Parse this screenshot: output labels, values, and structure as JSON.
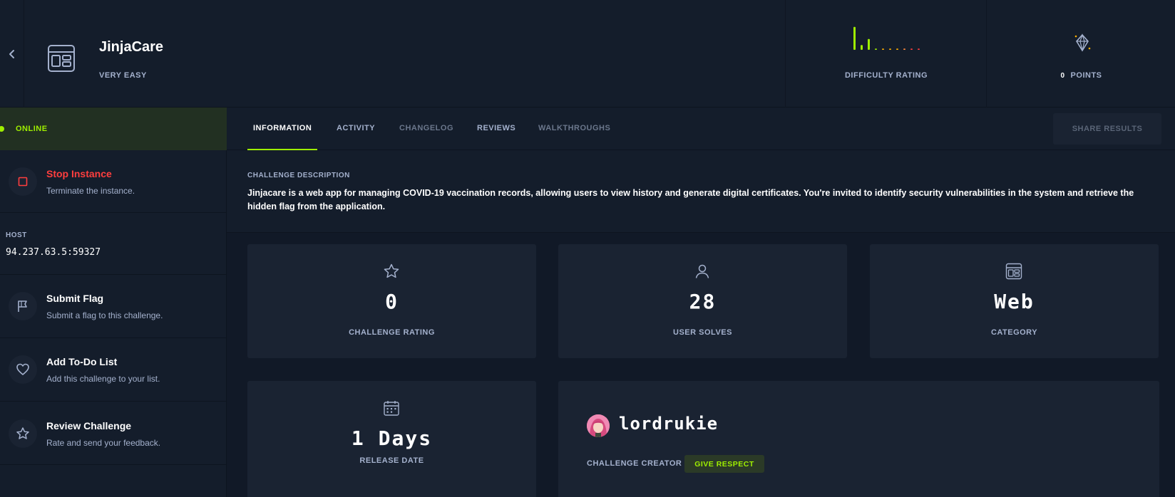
{
  "header": {
    "challenge_name": "JinjaCare",
    "difficulty": "VERY EASY",
    "difficulty_rating_label": "DIFFICULTY RATING",
    "points_value": "0",
    "points_label": "POINTS",
    "difficulty_distribution": [
      0.95,
      0.2,
      0.45,
      0.05,
      0.05,
      0.05,
      0.05,
      0.05,
      0.05,
      0.05
    ],
    "difficulty_colors": [
      "#9fef00",
      "#9fef00",
      "#9fef00",
      "#9fef00",
      "#ffaf00",
      "#ffaf00",
      "#ffaf00",
      "#ff8a3d",
      "#ff3e3e",
      "#ff3e3e"
    ]
  },
  "sidebar": {
    "status": "ONLINE",
    "stop_title": "Stop Instance",
    "stop_sub": "Terminate the instance.",
    "host_label": "HOST",
    "host_value": "94.237.63.5:59327",
    "submit_title": "Submit Flag",
    "submit_sub": "Submit a flag to this challenge.",
    "todo_title": "Add To-Do List",
    "todo_sub": "Add this challenge to your list.",
    "review_title": "Review Challenge",
    "review_sub": "Rate and send your feedback."
  },
  "tabs": {
    "information": "INFORMATION",
    "activity": "ACTIVITY",
    "changelog": "CHANGELOG",
    "reviews": "REVIEWS",
    "walkthroughs": "WALKTHROUGHS",
    "share": "SHARE RESULTS"
  },
  "description": {
    "title": "CHALLENGE DESCRIPTION",
    "text": "Jinjacare is a web app for managing COVID-19 vaccination records, allowing users to view history and generate digital certificates. You're invited to identify security vulnerabilities in the system and retrieve the hidden flag from the application."
  },
  "stats": {
    "rating_value": "0",
    "rating_label": "CHALLENGE RATING",
    "solves_value": "28",
    "solves_label": "USER SOLVES",
    "category_value": "Web",
    "category_label": "CATEGORY",
    "release_value": "1 Days",
    "release_label": "RELEASE DATE"
  },
  "creator": {
    "name": "lordrukie",
    "label": "CHALLENGE CREATOR",
    "respect": "GIVE RESPECT"
  },
  "colors": {
    "accent": "#9fef00",
    "danger": "#ff3e3e",
    "bg": "#111927",
    "panel": "#141d2b",
    "card": "#1a2332"
  }
}
